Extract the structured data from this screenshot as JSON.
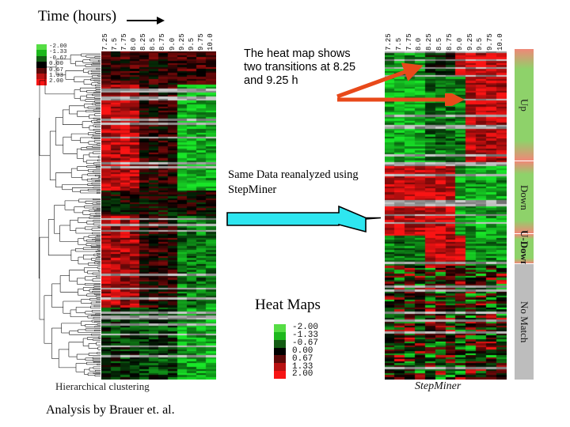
{
  "axis": {
    "time_title": "Time (hours)",
    "arrow_icon": "right-arrow-icon"
  },
  "time_ticks": [
    "7.25",
    "7.5",
    "7.75",
    "8.0",
    "8.25",
    "8.5",
    "8.75",
    "9.0",
    "9.25",
    "9.5",
    "9.75",
    "10.0"
  ],
  "legend": {
    "values": [
      "-2.00",
      "-1.33",
      "-0.67",
      "0.00",
      "0.67",
      "1.33",
      "2.00"
    ],
    "colors": [
      "#55dd44",
      "#1db81d",
      "#145c14",
      "#000000",
      "#5c0a0a",
      "#b81111",
      "#f71414"
    ]
  },
  "annotations": {
    "transitions": "The heat map shows two transitions at 8.25 and 9.25 h",
    "reanalyzed": "Same Data reanalyzed using StepMiner",
    "heat_maps_heading": "Heat Maps"
  },
  "captions": {
    "left_panel": "Hierarchical clustering",
    "right_panel": "StepMiner",
    "credit": "Analysis by Brauer et. al."
  },
  "categories": [
    {
      "label": "Up",
      "height_pct": 34,
      "top_color": "#f08878",
      "bottom_color": "#f08878",
      "mid_color": "#8ed26a",
      "bold": false
    },
    {
      "label": "Down",
      "height_pct": 22,
      "top_color": "#f08878",
      "bottom_color": "#f08878",
      "mid_color": "#8ed26a",
      "bold": false
    },
    {
      "label": "U-Down",
      "height_pct": 9,
      "top_color": "#f08878",
      "bottom_color": "#f08878",
      "mid_color": "#8ed26a",
      "bold": true
    },
    {
      "label": "No Match",
      "height_pct": 35,
      "top_color": "#bdbdbd",
      "bottom_color": "#bdbdbd",
      "mid_color": "#bdbdbd",
      "bold": false
    }
  ],
  "colors": {
    "callout_arrow": "#e8491a",
    "flow_arrow_fill": "#2ee6f0",
    "flow_arrow_stroke": "#000000",
    "heatmap_high": "#f71414",
    "heatmap_low": "#55dd44",
    "heatmap_mid": "#000000",
    "no_match": "#bdbdbd"
  },
  "chart_data": {
    "type": "heatmap",
    "title": "Heat Maps",
    "xlabel": "Time (hours)",
    "ylabel": "",
    "panels": [
      {
        "name": "Hierarchical clustering",
        "columns": [
          "7.25",
          "7.5",
          "7.75",
          "8.0",
          "8.25",
          "8.5",
          "8.75",
          "9.0",
          "9.25",
          "9.5",
          "9.75",
          "10.0"
        ],
        "rows": 170,
        "row_order": "hierarchical dendrogram",
        "notes": "Left block of rows predominantly red (up-regulated) through 8.75 then green after 9.0; mixed black/green bands interleaved."
      },
      {
        "name": "StepMiner",
        "columns": [
          "7.25",
          "7.5",
          "7.75",
          "8.0",
          "8.25",
          "8.5",
          "8.75",
          "9.0",
          "9.25",
          "9.5",
          "9.75",
          "10.0"
        ],
        "rows": 170,
        "row_order": "StepMiner category: Up, Down, U-Down, No Match",
        "notes": "Two step transitions visible at 8.25 h and 9.25 h."
      }
    ],
    "colorbar": {
      "ticks": [
        -2.0,
        -1.33,
        -0.67,
        0.0,
        0.67,
        1.33,
        2.0
      ],
      "low_color": "#55dd44",
      "mid_color": "#000000",
      "high_color": "#f71414"
    },
    "legend_position": "bottom-center and top-left",
    "grid": false
  }
}
